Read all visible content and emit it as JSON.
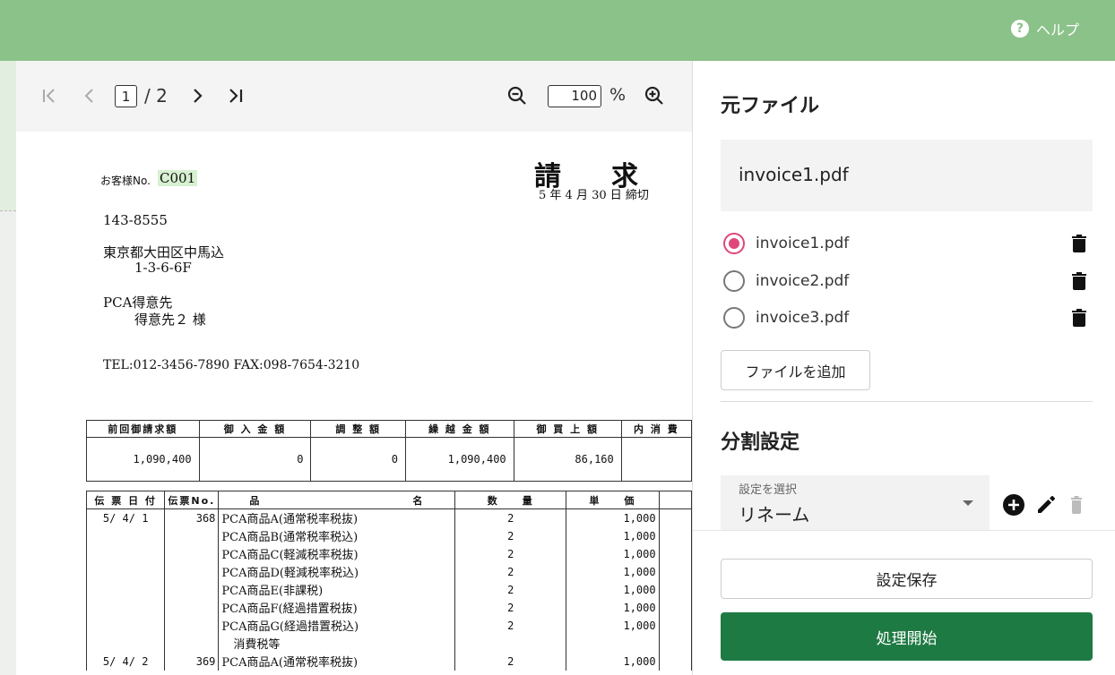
{
  "header": {
    "help_label": "ヘルプ",
    "help_icon": "?"
  },
  "viewer": {
    "toolbar": {
      "first_icon": "|<",
      "prev_icon": "<",
      "current_page": "1",
      "total_pages": "/ 2",
      "next_icon": ">",
      "last_icon": ">|",
      "zoom_value": "100",
      "zoom_unit": "%"
    },
    "document": {
      "customer_label": "お客様No.",
      "customer_no": "C001",
      "title": "請求",
      "date_line": "5 年  4 月 30 日  締切",
      "postal": "143-8555",
      "address1": "東京都大田区中馬込",
      "address2": "1-3-6-6F",
      "company": "PCA得意先",
      "person": "得意先２ 様",
      "contact": "TEL:012-3456-7890    FAX:098-7654-3210",
      "summary_headers": [
        "前回御請求額",
        "御 入 金 額",
        "調 整 額",
        "繰 越 金 額",
        "御 買 上 額",
        "内 消 費"
      ],
      "summary_values": [
        "1,090,400",
        "0",
        "0",
        "1,090,400",
        "86,160",
        ""
      ],
      "detail_headers": [
        "伝 票 日 付",
        "伝票No.",
        "品　　　　　　　　　　　　　名",
        "数　　量",
        "単　　価",
        ""
      ],
      "detail_rows": [
        [
          "5/ 4/ 1",
          "368",
          "PCA商品A(通常税率税抜)",
          "2",
          "1,000"
        ],
        [
          "",
          "",
          "PCA商品B(通常税率税込)",
          "2",
          "1,000"
        ],
        [
          "",
          "",
          "PCA商品C(軽減税率税抜)",
          "2",
          "1,000"
        ],
        [
          "",
          "",
          "PCA商品D(軽減税率税込)",
          "2",
          "1,000"
        ],
        [
          "",
          "",
          "PCA商品E(非課税)",
          "2",
          "1,000"
        ],
        [
          "",
          "",
          "PCA商品F(経過措置税抜)",
          "2",
          "1,000"
        ],
        [
          "",
          "",
          "PCA商品G(経過措置税込)",
          "2",
          "1,000"
        ],
        [
          "",
          "",
          "　消費税等",
          "",
          ""
        ],
        [
          "5/ 4/ 2",
          "369",
          "PCA商品A(通常税率税抜)",
          "2",
          "1,000"
        ]
      ]
    }
  },
  "panel": {
    "source_title": "元ファイル",
    "selected_file": "invoice1.pdf",
    "files": [
      {
        "name": "invoice1.pdf",
        "selected": true
      },
      {
        "name": "invoice2.pdf",
        "selected": false
      },
      {
        "name": "invoice3.pdf",
        "selected": false
      }
    ],
    "add_file_label": "ファイルを追加",
    "split_title": "分割設定",
    "select_label": "設定を選択",
    "select_value": "リネーム",
    "save_label": "設定保存",
    "start_label": "処理開始",
    "colors": {
      "accent": "#e0457b",
      "primary": "#1e7a43",
      "header": "#8bc28a"
    }
  }
}
